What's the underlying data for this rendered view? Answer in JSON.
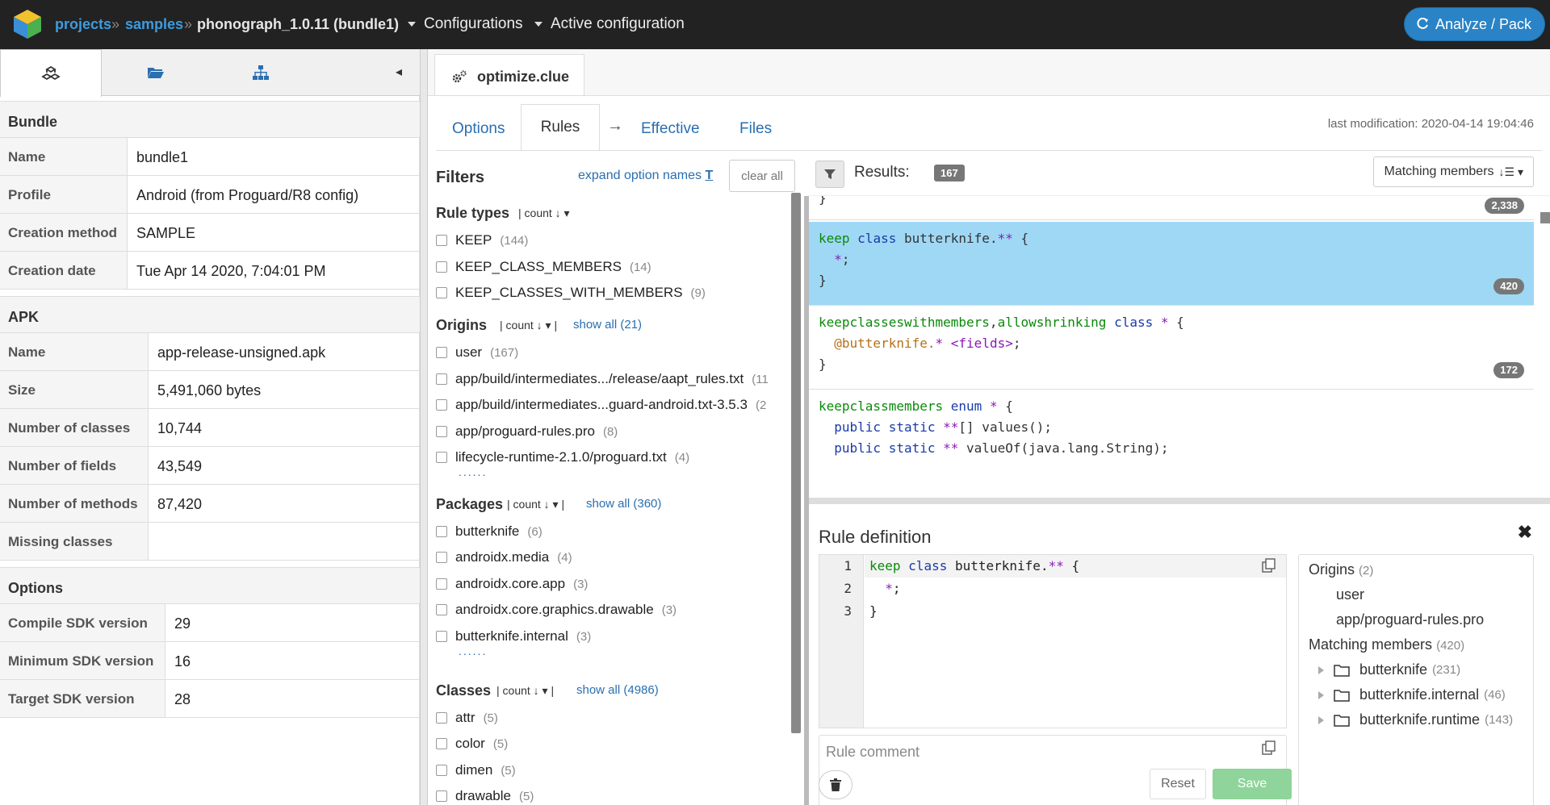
{
  "topbar": {
    "breadcrumb": [
      "projects",
      "samples",
      "phonograph_1.0.11 (bundle1)"
    ],
    "separator": "»",
    "menus": [
      "Configurations",
      "Active configuration"
    ],
    "analyze_label": "Analyze / Pack",
    "accent": "#2a83c6"
  },
  "left": {
    "tabs": [
      "bundle-icon",
      "folder-icon",
      "hierarchy-icon"
    ],
    "collapse": "◂",
    "sections": [
      {
        "title": "Bundle",
        "rows": [
          [
            "Name",
            "bundle1"
          ],
          [
            "Profile",
            "Android (from Proguard/R8 config)"
          ],
          [
            "Creation method",
            "SAMPLE"
          ],
          [
            "Creation date",
            "Tue Apr 14 2020, 7:04:01 PM"
          ]
        ]
      },
      {
        "title": "APK",
        "rows": [
          [
            "Name",
            "app-release-unsigned.apk"
          ],
          [
            "Size",
            "5,491,060 bytes"
          ],
          [
            "Number of classes",
            "10,744"
          ],
          [
            "Number of fields",
            "43,549"
          ],
          [
            "Number of methods",
            "87,420"
          ],
          [
            "Missing classes",
            ""
          ]
        ]
      },
      {
        "title": "Options",
        "rows": [
          [
            "Compile SDK version",
            "29"
          ],
          [
            "Minimum SDK version",
            "16"
          ],
          [
            "Target SDK version",
            "28"
          ]
        ]
      }
    ]
  },
  "editor_tab": {
    "file": "optimize.clue"
  },
  "nav": {
    "tabs": [
      "Options",
      "Rules",
      "Effective",
      "Files"
    ],
    "arrow": "→",
    "last_modification": "last modification: 2020-04-14 19:04:46"
  },
  "filters": {
    "title": "Filters",
    "expand": "expand option names",
    "clear": "clear all",
    "sort_label": "count",
    "groups": {
      "rule_types": {
        "title": "Rule types",
        "items": [
          [
            "KEEP",
            "(144)"
          ],
          [
            "KEEP_CLASS_MEMBERS",
            "(14)"
          ],
          [
            "KEEP_CLASSES_WITH_MEMBERS",
            "(9)"
          ]
        ]
      },
      "origins": {
        "title": "Origins",
        "show_all": "show all (21)",
        "items": [
          [
            "user",
            "(167)"
          ],
          [
            "app/build/intermediates.../release/aapt_rules.txt",
            "(11"
          ],
          [
            "app/build/intermediates...guard-android.txt-3.5.3",
            "(2"
          ],
          [
            "app/proguard-rules.pro",
            "(8)"
          ],
          [
            "lifecycle-runtime-2.1.0/proguard.txt",
            "(4)"
          ]
        ]
      },
      "packages": {
        "title": "Packages",
        "show_all": "show all (360)",
        "items": [
          [
            "butterknife",
            "(6)"
          ],
          [
            "androidx.media",
            "(4)"
          ],
          [
            "androidx.core.app",
            "(3)"
          ],
          [
            "androidx.core.graphics.drawable",
            "(3)"
          ],
          [
            "butterknife.internal",
            "(3)"
          ]
        ]
      },
      "classes": {
        "title": "Classes",
        "show_all": "show all (4986)",
        "items": [
          [
            "attr",
            "(5)"
          ],
          [
            "color",
            "(5)"
          ],
          [
            "dimen",
            "(5)"
          ],
          [
            "drawable",
            "(5)"
          ]
        ]
      }
    },
    "more": "......"
  },
  "results": {
    "label": "Results:",
    "count": "167",
    "matching_label": "Matching members",
    "prev_badge": "2,338",
    "rules": [
      {
        "badge": "420"
      },
      {
        "badge": "172"
      }
    ]
  },
  "rule_definition": {
    "title": "Rule definition",
    "close": "✖",
    "line_numbers": [
      "1",
      "2",
      "3"
    ],
    "comment_placeholder": "Rule comment",
    "reset": "Reset",
    "save": "Save",
    "origins_label": "Origins",
    "origins_count": "(2)",
    "origins": [
      "user",
      "app/proguard-rules.pro"
    ],
    "matching_label": "Matching members",
    "matching_count": "(420)",
    "members": [
      [
        "butterknife",
        "(231)"
      ],
      [
        "butterknife.internal",
        "(46)"
      ],
      [
        "butterknife.runtime",
        "(143)"
      ]
    ]
  }
}
